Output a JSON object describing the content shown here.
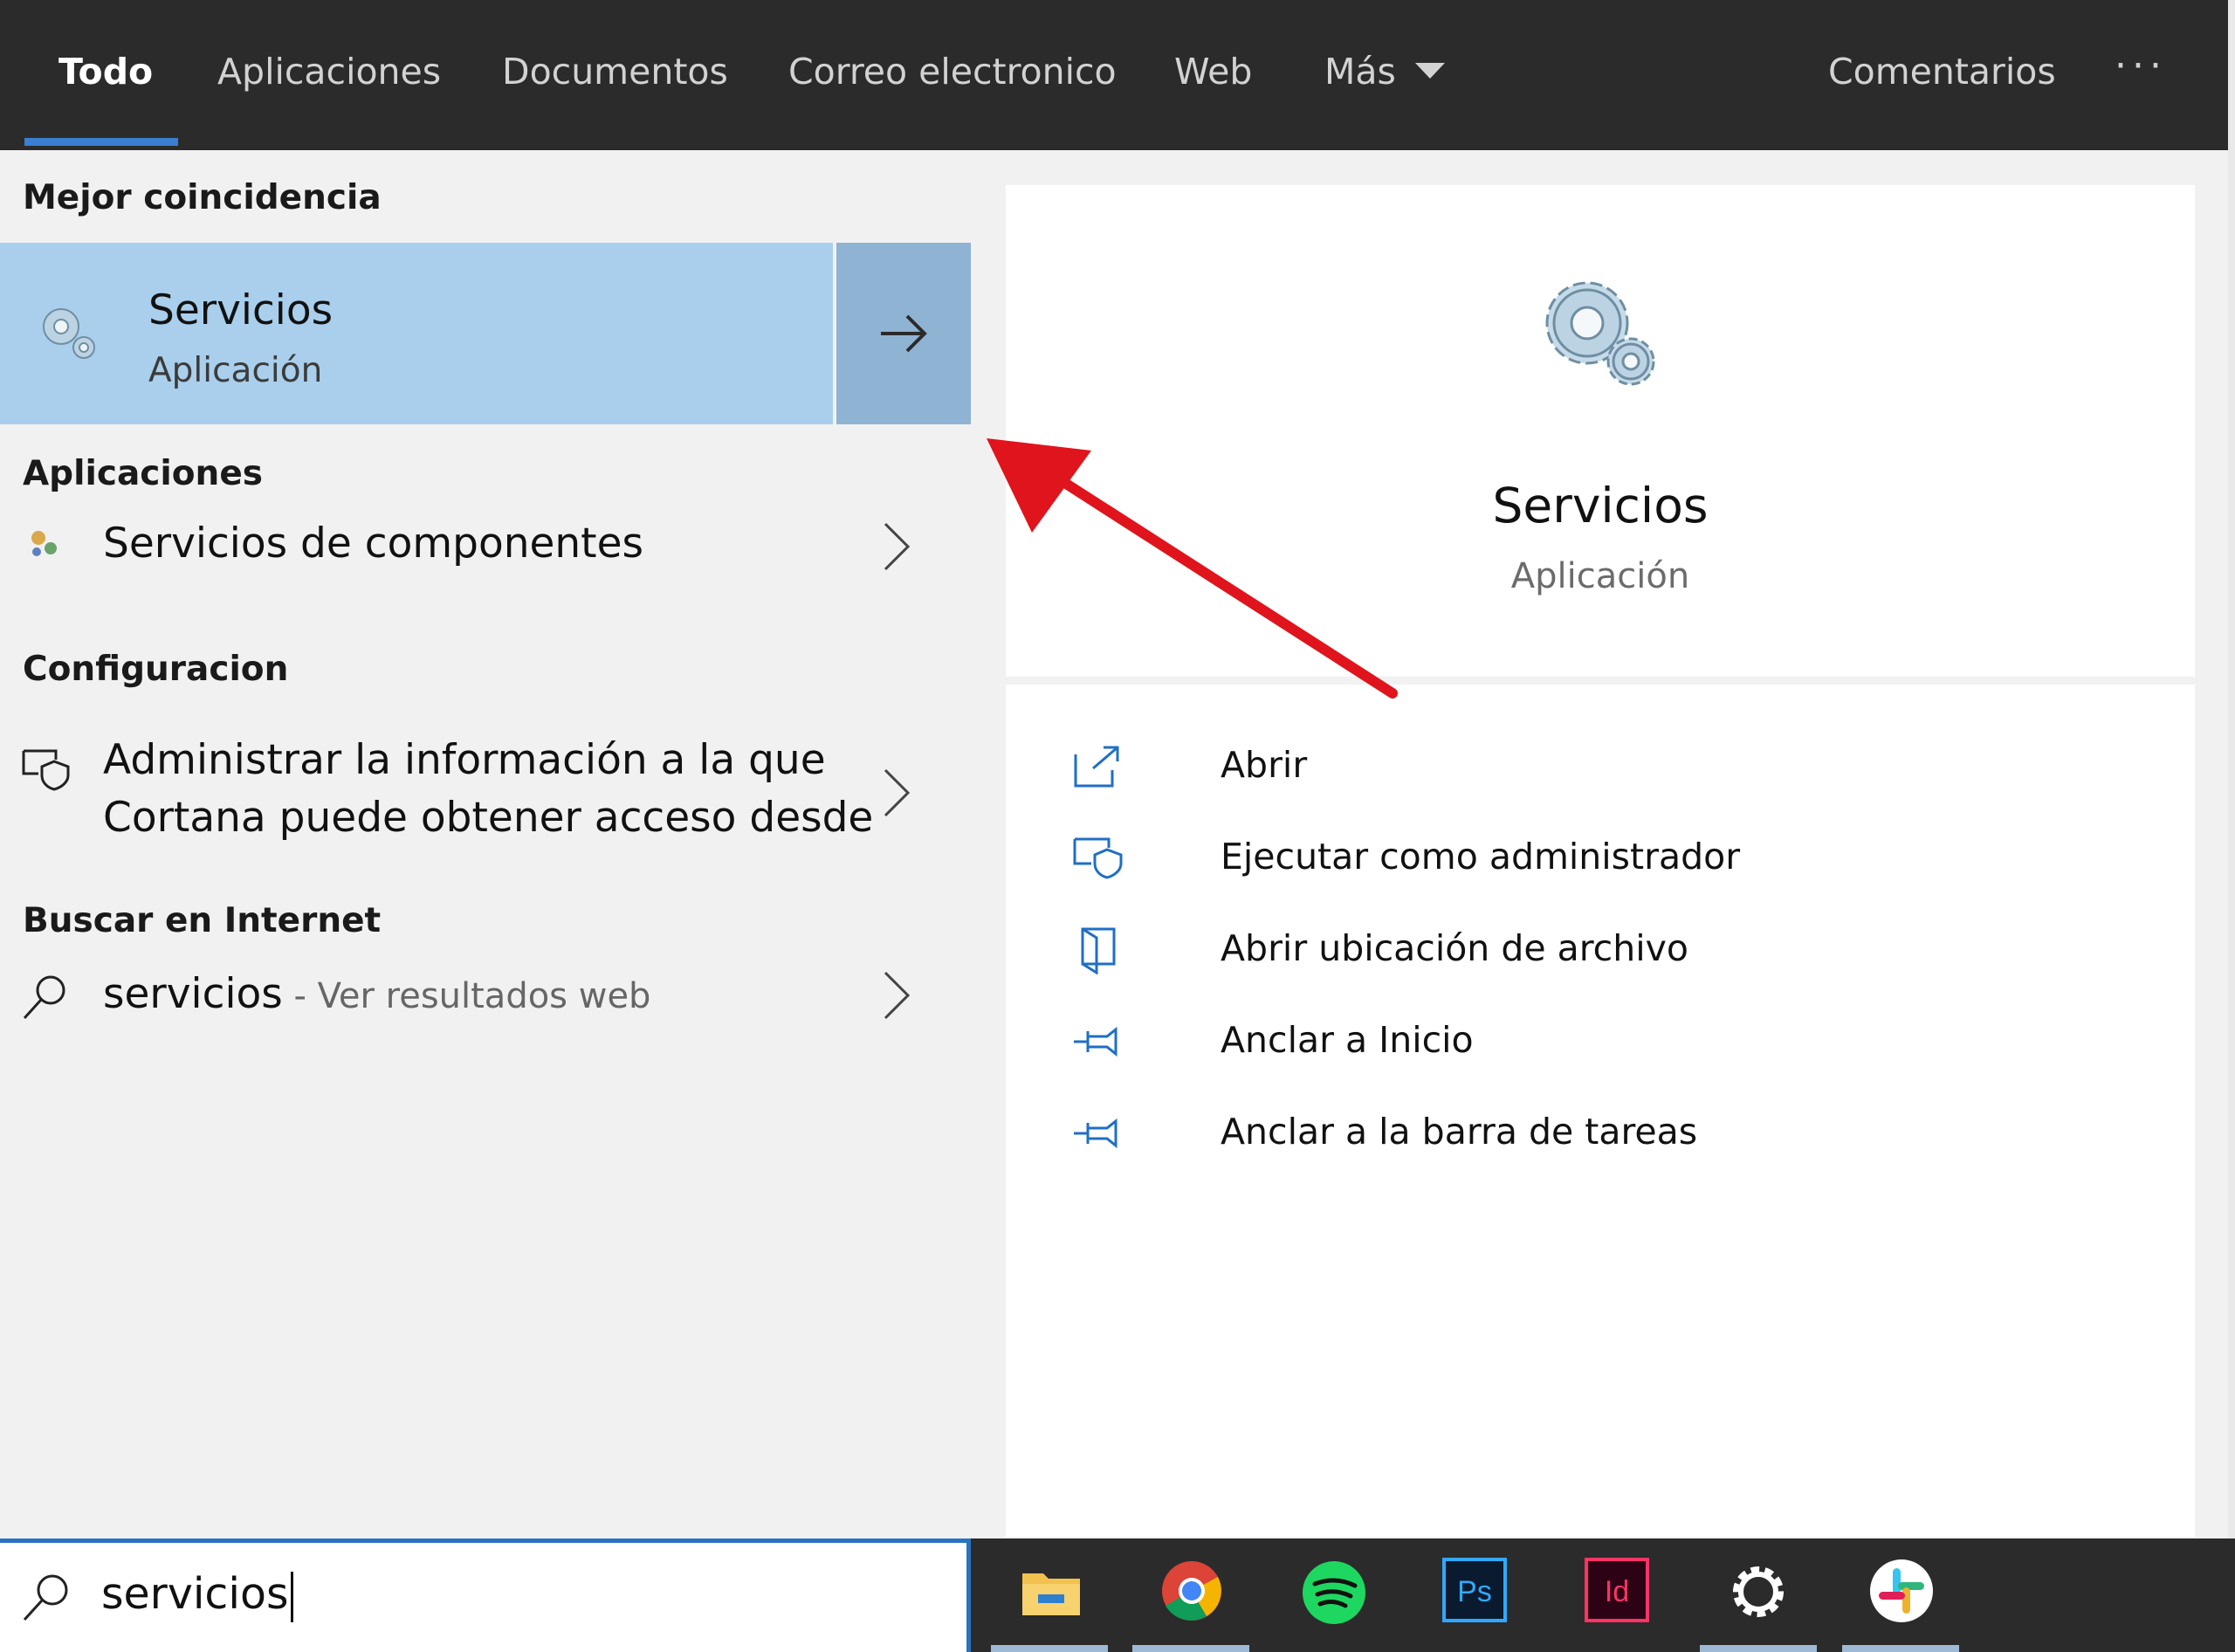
{
  "tabs": [
    {
      "label": "Todo",
      "active": true
    },
    {
      "label": "Aplicaciones"
    },
    {
      "label": "Documentos"
    },
    {
      "label": "Correo electronico"
    },
    {
      "label": "Web"
    },
    {
      "label": "Más"
    }
  ],
  "header": {
    "feedback": "Comentarios",
    "more": "···"
  },
  "sections": {
    "best": "Mejor coincidencia",
    "apps": "Aplicaciones",
    "settings": "Configuracion",
    "web": "Buscar en Internet"
  },
  "best_match": {
    "title": "Servicios",
    "subtitle": "Aplicación",
    "icon": "gears-icon"
  },
  "apps_result": {
    "bold": "Servicios",
    "rest": " de componentes"
  },
  "settings_result": {
    "line1": "Administrar la información a la que",
    "line2": "Cortana puede obtener acceso desde"
  },
  "web_result": {
    "query": "servicios",
    "suffix": " - Ver resultados web"
  },
  "preview": {
    "title": "Servicios",
    "subtitle": "Aplicación"
  },
  "actions": [
    {
      "label": "Abrir",
      "icon": "open-icon"
    },
    {
      "label": "Ejecutar como administrador",
      "icon": "shield-icon"
    },
    {
      "label": "Abrir ubicación de archivo",
      "icon": "file-location-icon"
    },
    {
      "label": "Anclar a Inicio",
      "icon": "pin-icon"
    },
    {
      "label": "Anclar a la barra de tareas",
      "icon": "pin-icon"
    }
  ],
  "search": {
    "value": "servicios"
  },
  "taskbar": [
    "file-explorer",
    "chrome",
    "spotify",
    "photoshop",
    "indesign",
    "settings",
    "slack"
  ],
  "colors": {
    "accent": "#2a73c2",
    "highlight": "#a9cfec",
    "arrow": "#e0141c"
  }
}
